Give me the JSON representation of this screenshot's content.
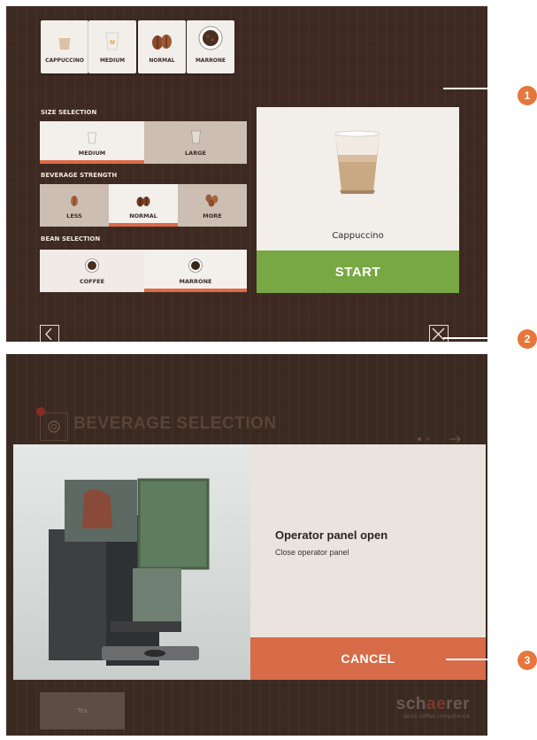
{
  "panel1": {
    "quick_select": [
      {
        "label": "CAPPUCCINO",
        "icon": "cappuccino-cup-icon"
      },
      {
        "label": "MEDIUM",
        "icon": "medium-cup-icon"
      },
      {
        "label": "NORMAL",
        "icon": "coffee-beans-icon"
      },
      {
        "label": "MARRONE",
        "icon": "bean-bowl-icon"
      }
    ],
    "size": {
      "title": "SIZE SELECTION",
      "options": [
        {
          "label": "MEDIUM",
          "selected": true
        },
        {
          "label": "LARGE",
          "selected": false
        }
      ]
    },
    "strength": {
      "title": "BEVERAGE STRENGTH",
      "options": [
        {
          "label": "LESS",
          "selected": false
        },
        {
          "label": "NORMAL",
          "selected": true
        },
        {
          "label": "MORE",
          "selected": false
        }
      ]
    },
    "bean": {
      "title": "BEAN SELECTION",
      "options": [
        {
          "label": "COFFEE",
          "selected": false
        },
        {
          "label": "MARRONE",
          "selected": true
        }
      ]
    },
    "preview": {
      "name": "Cappuccino"
    },
    "start_label": "START",
    "nav": {
      "back_icon": "chevron-left-icon",
      "close_icon": "close-icon"
    }
  },
  "panel2": {
    "background_title": "BEVERAGE SELECTION",
    "modal": {
      "title": "Operator panel open",
      "subtitle": "Close operator panel",
      "cancel_label": "CANCEL"
    },
    "tea_label": "Tea",
    "logo": {
      "brand_pre": "sch",
      "brand_mid": "ae",
      "brand_post": "rer",
      "tagline": "swiss coffee competence"
    }
  },
  "callouts": [
    "1",
    "2",
    "3"
  ],
  "colors": {
    "accent": "#dd6b45",
    "start": "#78a843",
    "cancel": "#d86b48",
    "callout": "#e5773d",
    "panel_bg": "#3e2a22"
  }
}
